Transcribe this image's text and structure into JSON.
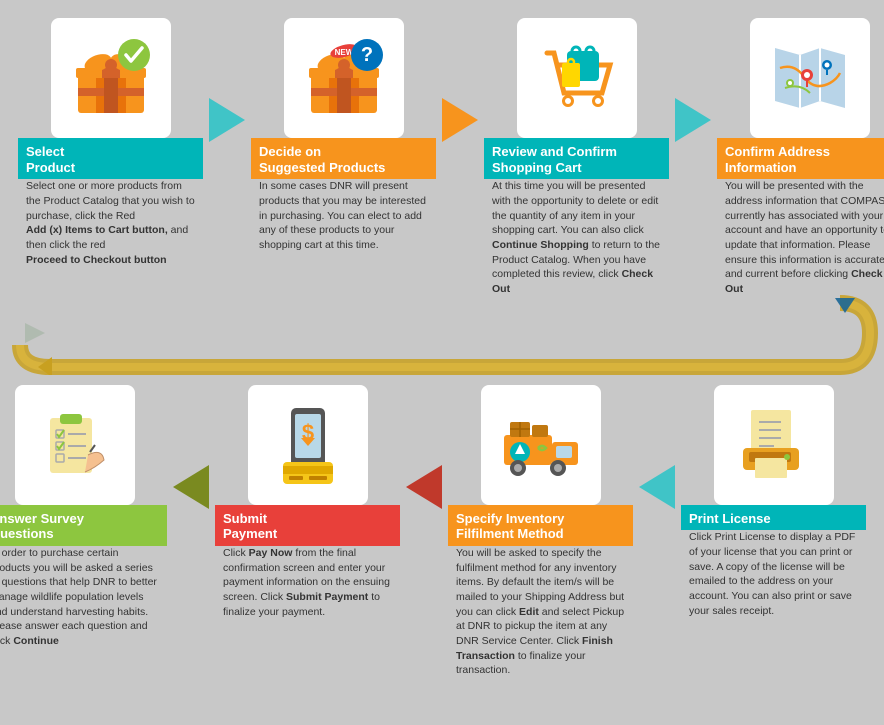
{
  "steps": {
    "top": [
      {
        "id": "select-product",
        "label": "Select\nProduct",
        "label_color": "teal",
        "desc": "Select one or more products from the Product Catalog that you wish to purchase, click the Red",
        "desc_bold1": "Add (x) Items to Cart button,",
        "desc_after1": " and then click the red",
        "desc_bold2": "Proceed to Checkout button",
        "icon": "gift-check"
      },
      {
        "id": "decide-suggested",
        "label": "Decide on\nSuggested Products",
        "label_color": "orange",
        "desc": "In some cases DNR will present products that you may be interested in purchasing. You can elect to add any of these products to your shopping cart at this time.",
        "icon": "gift-question"
      },
      {
        "id": "review-cart",
        "label": "Review and Confirm\nShopping Cart",
        "label_color": "teal",
        "desc_before": "At this time you will be presented with the opportunity to delete or edit the quantity of any item in your shopping cart. You can also click",
        "desc_bold1": "Continue Shopping",
        "desc_after1": " to return to the Product Catalog. When you have completed this review, click",
        "desc_bold2": "Check Out",
        "icon": "shopping-cart"
      },
      {
        "id": "confirm-address",
        "label": "Confirm Address\nInformation",
        "label_color": "orange",
        "desc_before": "You will be presented with the address information that COMPASS currently has associated with your account and have an opportunity to update that information. Please ensure this information is accurate and current before clicking",
        "desc_bold1": "Check Out",
        "icon": "map"
      }
    ],
    "bottom": [
      {
        "id": "print-license",
        "label": "Print License",
        "label_color": "teal",
        "desc": "Click Print License to display a PDF of your license that you can print or save. A copy of the license will be emailed to the address on your account. You can also print or save your sales receipt.",
        "icon": "printer"
      },
      {
        "id": "specify-inventory",
        "label": "Specify Inventory\nFilfilment Method",
        "label_color": "orange",
        "desc_before": "You will be asked to specify the fulfilment method for any inventory items. By default the item/s will be mailed to your Shipping Address but you can click",
        "desc_bold1": "Edit",
        "desc_after1": " and select Pickup at DNR to pickup the item at any DNR Service Center. Click",
        "desc_bold2": "Finish Transaction",
        "desc_after2": " to finalize your transaction.",
        "icon": "truck"
      },
      {
        "id": "submit-payment",
        "label": "Submit\nPayment",
        "label_color": "red",
        "desc_before": "Click",
        "desc_bold1": "Pay Now",
        "desc_after1": " from the final confirmation screen and enter your payment information on the ensuing screen. Click",
        "desc_bold2": "Submit Payment",
        "desc_after2": " to finalize your payment.",
        "icon": "payment"
      },
      {
        "id": "answer-survey",
        "label": "Answer Survey\nQuestions",
        "label_color": "green",
        "desc_before": "In order to purchase certain products you will be asked a series of questions that help DNR to better manage wildlife population levels and understand harvesting habits. Please answer each question and click",
        "desc_bold1": "Continue",
        "icon": "survey"
      }
    ]
  }
}
